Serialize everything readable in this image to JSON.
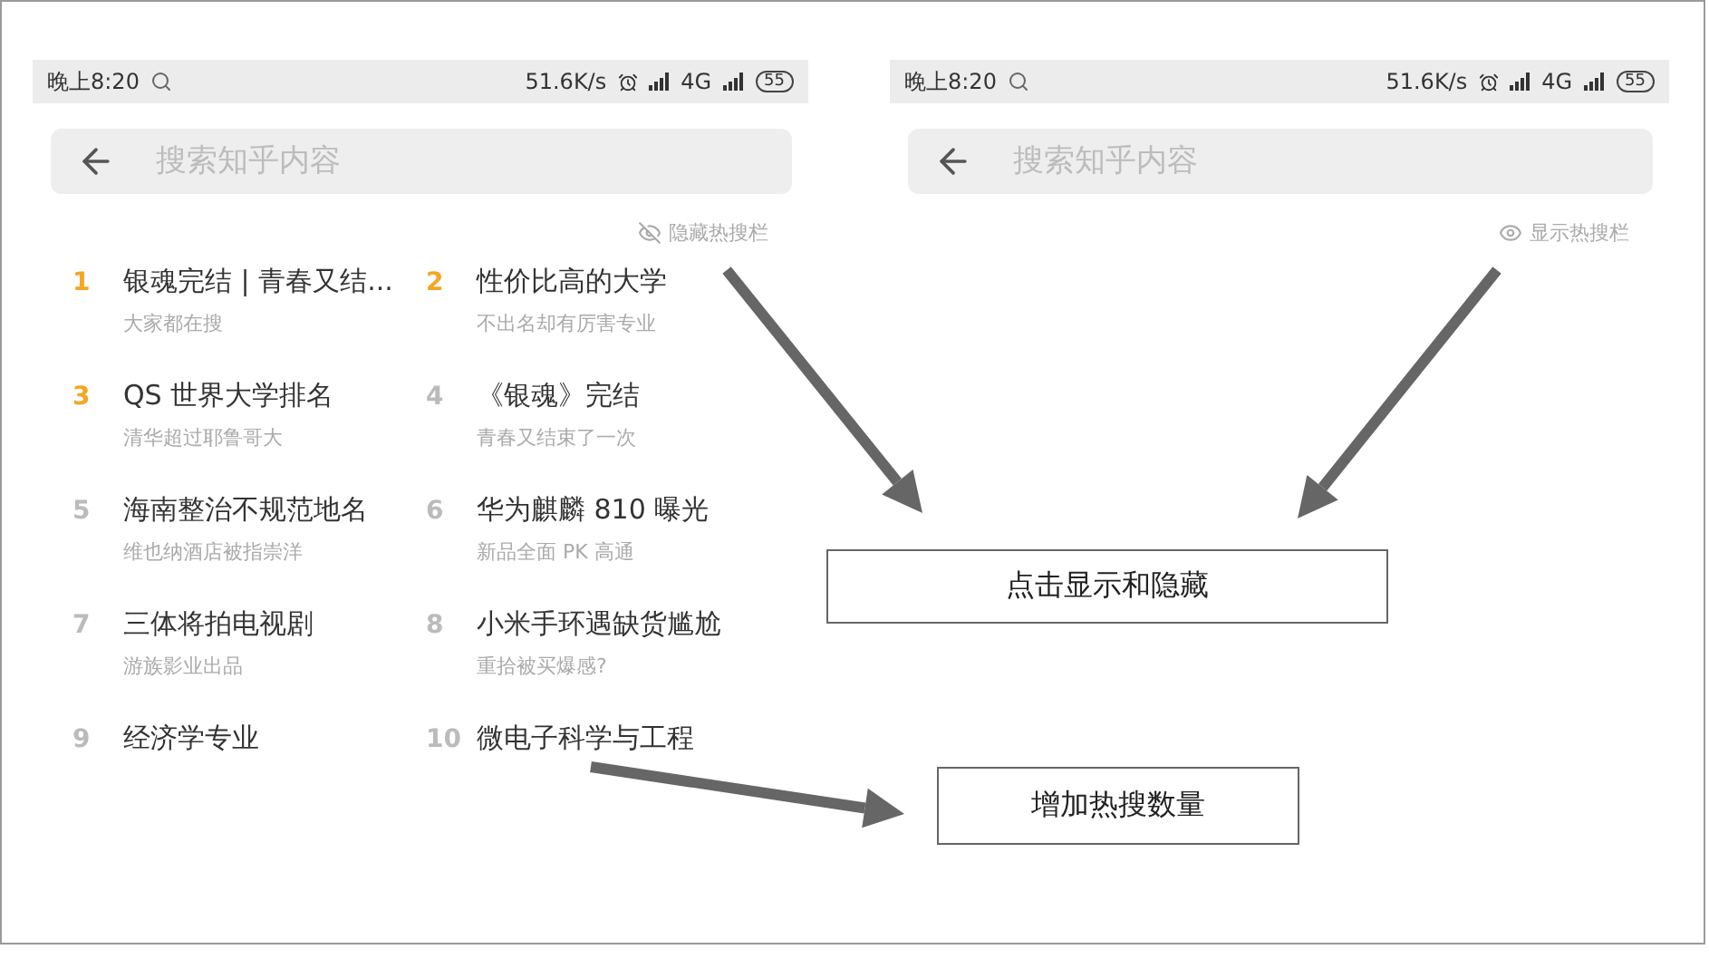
{
  "phones": [
    {
      "status_bar": {
        "time": "晚上8:20",
        "speed": "51.6K/s",
        "network": "4G",
        "battery": "55"
      },
      "search": {
        "placeholder": "搜索知乎内容"
      },
      "toggle": {
        "kind": "hide",
        "label": "隐藏热搜栏"
      },
      "hot_list": [
        {
          "rank": "1",
          "title": "银魂完结 | 青春又结...",
          "subtitle": "大家都在搜",
          "top": true
        },
        {
          "rank": "2",
          "title": "性价比高的大学",
          "subtitle": "不出名却有厉害专业",
          "top": true
        },
        {
          "rank": "3",
          "title": "QS 世界大学排名",
          "subtitle": "清华超过耶鲁哥大",
          "top": true
        },
        {
          "rank": "4",
          "title": "《银魂》完结",
          "subtitle": "青春又结束了一次",
          "top": false
        },
        {
          "rank": "5",
          "title": "海南整治不规范地名",
          "subtitle": "维也纳酒店被指崇洋",
          "top": false
        },
        {
          "rank": "6",
          "title": "华为麒麟 810 曝光",
          "subtitle": "新品全面 PK 高通",
          "top": false
        },
        {
          "rank": "7",
          "title": "三体将拍电视剧",
          "subtitle": "游族影业出品",
          "top": false
        },
        {
          "rank": "8",
          "title": "小米手环遇缺货尴尬",
          "subtitle": "重拾被买爆感?",
          "top": false
        },
        {
          "rank": "9",
          "title": "经济学专业",
          "top": false
        },
        {
          "rank": "10",
          "title": "微电子科学与工程",
          "top": false
        }
      ]
    },
    {
      "status_bar": {
        "time": "晚上8:20",
        "speed": "51.6K/s",
        "network": "4G",
        "battery": "55"
      },
      "search": {
        "placeholder": "搜索知乎内容"
      },
      "toggle": {
        "kind": "show",
        "label": "显示热搜栏"
      }
    }
  ],
  "callouts": [
    {
      "text": "点击显示和隐藏"
    },
    {
      "text": "增加热搜数量"
    }
  ]
}
